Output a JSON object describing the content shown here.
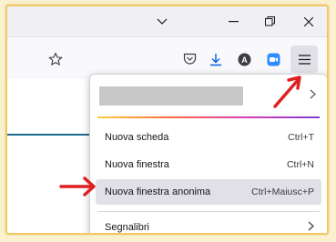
{
  "window": {
    "controls": {
      "chevron": "chevron-down-icon",
      "minimize": "minimize-icon",
      "restore": "restore-icon",
      "close": "close-icon"
    }
  },
  "toolbar": {
    "icons": [
      "bookmark-star-icon",
      "pocket-icon",
      "download-icon",
      "account-icon",
      "extension-icon",
      "hamburger-menu-icon"
    ],
    "account_letter": "A"
  },
  "menu": {
    "items": [
      {
        "label": "Nuova scheda",
        "shortcut": "Ctrl+T"
      },
      {
        "label": "Nuova finestra",
        "shortcut": "Ctrl+N"
      },
      {
        "label": "Nuova finestra anonima",
        "shortcut": "Ctrl+Maiusc+P"
      },
      {
        "label": "Segnalibri",
        "shortcut": ""
      }
    ],
    "highlight_color": "#e0e0e6"
  },
  "colors": {
    "frame_border": "#f2c95e",
    "annotation": "#e02020",
    "accent": "#0060df"
  }
}
